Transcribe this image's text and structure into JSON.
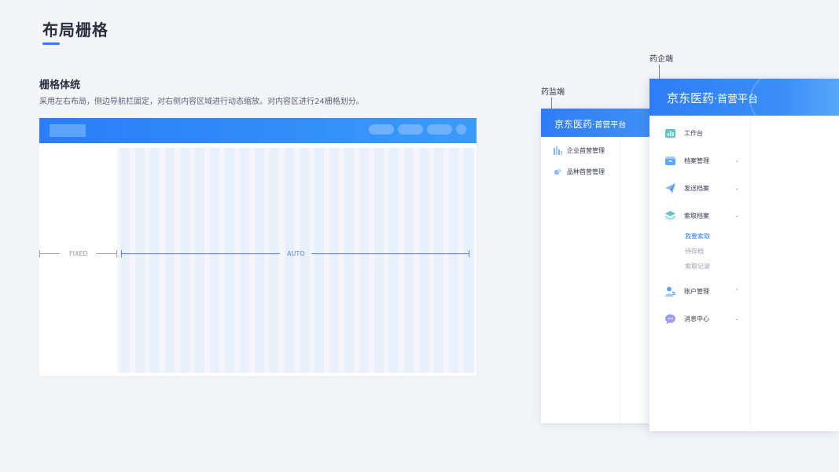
{
  "page": {
    "title": "布局栅格",
    "section_title": "栅格体统",
    "section_desc": "采用左右布局，侧边导航栏固定，对右侧内容区域进行动态缩放。对内容区进行24栅格划分。"
  },
  "grid_demo": {
    "columns": 24,
    "fixed_label": "FIXED",
    "auto_label": "AUTO",
    "header_color": "#2f7df6",
    "column_color": "#e8f0fb"
  },
  "regulator_panel": {
    "callout": "药监端",
    "logo_main": "京东医药",
    "logo_sub": "·首营平台",
    "menu": [
      {
        "label": "企业首营管理",
        "icon": "building-chart-icon"
      },
      {
        "label": "品种首营管理",
        "icon": "pills-icon"
      }
    ]
  },
  "enterprise_panel": {
    "callout": "药企端",
    "logo_main": "京东医药",
    "logo_sub": "·首营平台",
    "menu": [
      {
        "label": "工作台",
        "icon": "dashboard-icon",
        "chevron": ""
      },
      {
        "label": "档案管理",
        "icon": "archive-box-icon",
        "chevron": "⌄"
      },
      {
        "label": "发送档案",
        "icon": "paper-plane-icon",
        "chevron": "⌄"
      },
      {
        "label": "索取档案",
        "icon": "stack-icon",
        "chevron": "⌄"
      },
      {
        "label": "账户管理",
        "icon": "user-icon",
        "chevron": "⌃"
      },
      {
        "label": "消息中心",
        "icon": "chat-bubble-icon",
        "chevron": "⌄"
      }
    ],
    "submenu": [
      {
        "label": "我要索取",
        "active": true
      },
      {
        "label": "待存档",
        "active": false
      },
      {
        "label": "索取记录",
        "active": false
      }
    ]
  },
  "colors": {
    "accent": "#2f7cf6",
    "background": "#f4f5f9",
    "text_dark": "#2a3042",
    "text_muted": "#9aa1af"
  }
}
